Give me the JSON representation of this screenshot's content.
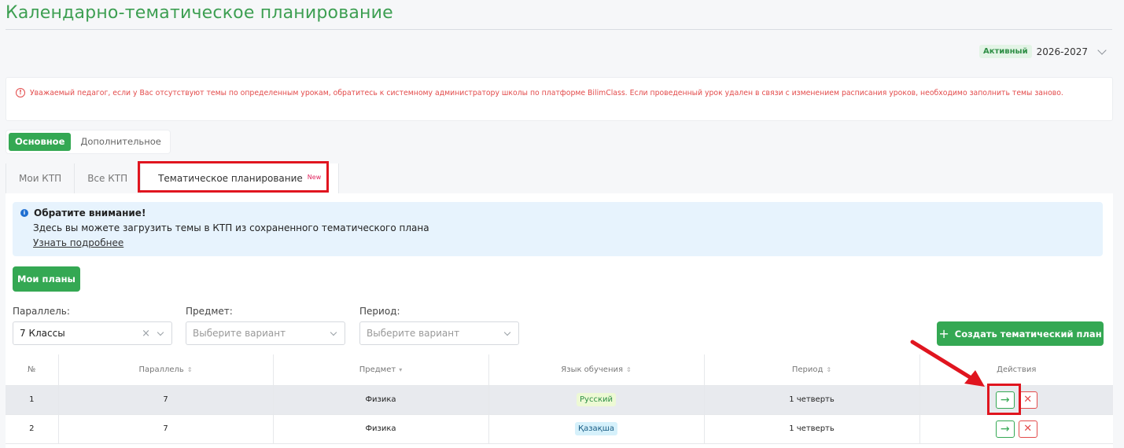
{
  "page": {
    "title": "Календарно-тематическое планирование"
  },
  "year_selector": {
    "badge": "Активный",
    "value": "2026-2027"
  },
  "warning": {
    "icon_glyph": "!",
    "text": "Уважаемый педагог, если у Вас отсутствуют темы по определенным урокам, обратитесь к системному администратору школы по платформе BilimClass. Если проведенный урок удален в связи с изменением расписания уроков, необходимо заполнить темы заново."
  },
  "segment": {
    "main": "Основное",
    "extra": "Дополнительное"
  },
  "tabs": {
    "my_ktp": "Мои КТП",
    "all_ktp": "Все КТП",
    "thematic": "Тематическое планирование",
    "new_badge": "New"
  },
  "notice": {
    "icon_glyph": "i",
    "title": "Обратите внимание!",
    "body": "Здесь вы можете загрузить темы в КТП из сохраненного тематического плана",
    "link": "Узнать подробнее"
  },
  "buttons": {
    "my_plans": "Мои планы",
    "create_plan": "Создать тематический план",
    "plus_glyph": "+"
  },
  "filters": {
    "parallel": {
      "label": "Параллель:",
      "value": "7 Классы"
    },
    "subject": {
      "label": "Предмет:",
      "placeholder": "Выберите вариант"
    },
    "period": {
      "label": "Период:",
      "placeholder": "Выберите вариант"
    },
    "clear_glyph": "×"
  },
  "table": {
    "headers": {
      "num": "№",
      "parallel": "Параллель",
      "subject": "Предмет",
      "language": "Язык обучения",
      "period": "Период",
      "actions": "Действия"
    },
    "sort_glyph": "⇕",
    "sort_down_glyph": "▾",
    "rows": [
      {
        "num": "1",
        "parallel": "7",
        "subject": "Физика",
        "language": "Русский",
        "period": "1 четверть"
      },
      {
        "num": "2",
        "parallel": "7",
        "subject": "Физика",
        "language": "Қазақша",
        "period": "1 четверть"
      }
    ],
    "action_go_glyph": "→",
    "action_delete_glyph": "✕"
  },
  "colors": {
    "brand_green": "#34a853",
    "title_green": "#3d9f52",
    "warning_red": "#e34b4b",
    "highlight_red": "#e0151f",
    "notice_bg": "#e7f3fd"
  }
}
